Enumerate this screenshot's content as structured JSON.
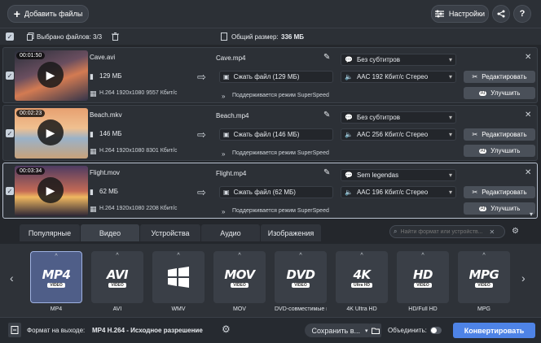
{
  "toolbar": {
    "add_files_label": "Добавить файлы",
    "settings_label": "Настройки",
    "help_label": "?"
  },
  "info": {
    "selected_label": "Выбрано файлов:",
    "selected_value": "3/3",
    "total_size_label": "Общий размер:",
    "total_size_value": "336 МБ"
  },
  "files": [
    {
      "duration": "00:01:50",
      "name": "Cave.avi",
      "size": "129 МБ",
      "codec": "H.264 1920x1080 9557 Кбит/с",
      "output_name": "Cave.mp4",
      "compress": "Сжать файл (129 МБ)",
      "superspeed": "Поддерживается режим SuperSpeed",
      "subtitles": "Без субтитров",
      "audio": "AAC 192 Кбит/с Стерео",
      "edit_label": "Редактировать",
      "enhance_label": "Улучшить"
    },
    {
      "duration": "00:02:23",
      "name": "Beach.mkv",
      "size": "146 МБ",
      "codec": "H.264 1920x1080 8301 Кбит/с",
      "output_name": "Beach.mp4",
      "compress": "Сжать файл (146 МБ)",
      "superspeed": "Поддерживается режим SuperSpeed",
      "subtitles": "Без субтитров",
      "audio": "AAC 256 Кбит/с Стерео",
      "edit_label": "Редактировать",
      "enhance_label": "Улучшить"
    },
    {
      "duration": "00:03:34",
      "name": "Flight.mov",
      "size": "62 МБ",
      "codec": "H.264 1920x1080 2208 Кбит/с",
      "output_name": "Flight.mp4",
      "compress": "Сжать файл (62 МБ)",
      "superspeed": "Поддерживается режим SuperSpeed",
      "subtitles": "Sem legendas",
      "audio": "AAC 196 Кбит/с Стерео",
      "edit_label": "Редактировать",
      "enhance_label": "Улучшить"
    }
  ],
  "tabs": [
    "Популярные",
    "Видео",
    "Устройства",
    "Аудио",
    "Изображения"
  ],
  "active_tab": "Видео",
  "search": {
    "placeholder": "Найти формат или устройств..."
  },
  "formats": [
    {
      "logo": "MP4",
      "sub": "VIDEO",
      "label": "MP4"
    },
    {
      "logo": "AVI",
      "sub": "VIDEO",
      "label": "AVI"
    },
    {
      "logo": "",
      "sub": "",
      "label": "WMV"
    },
    {
      "logo": "MOV",
      "sub": "VIDEO",
      "label": "MOV"
    },
    {
      "logo": "DVD",
      "sub": "VIDEO",
      "label": "DVD-совместимые в..."
    },
    {
      "logo": "4K",
      "sub": "Ultra HD",
      "label": "4K Ultra HD"
    },
    {
      "logo": "HD",
      "sub": "VIDEO",
      "label": "HD/Full HD"
    },
    {
      "logo": "MPG",
      "sub": "VIDEO",
      "label": "MPG"
    }
  ],
  "bottom": {
    "output_label": "Формат на выходе:",
    "output_value": "MP4 H.264 - Исходное разрешение",
    "save_label": "Сохранить в...",
    "merge_label": "Объединить:",
    "convert_label": "Конвертировать"
  },
  "colors": {
    "accent": "#4e83e6",
    "background": "#272a30",
    "selected_format": "#4f5e88"
  }
}
